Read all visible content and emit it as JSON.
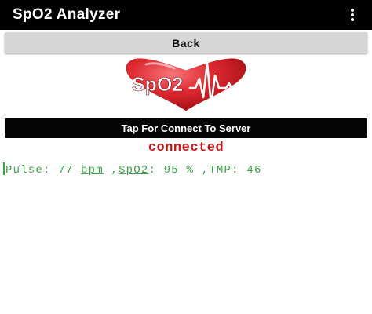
{
  "app_bar": {
    "title": "SpO2 Analyzer",
    "menu_icon": "overflow-menu-icon"
  },
  "back_button": {
    "label": "Back"
  },
  "logo": {
    "text": "SpO2",
    "icon": "heart-pulse-logo"
  },
  "connect_button": {
    "label": "Tap For Connect To Server"
  },
  "status": {
    "text": "connected"
  },
  "readings": {
    "pulse_label": "Pulse:",
    "pulse_value": "77",
    "pulse_unit": "bpm",
    "sep1": ",",
    "spo2_label": "SpO2",
    "spo2_colon": ":",
    "spo2_value": "95",
    "spo2_unit": "%",
    "sep2": ",",
    "tmp_label": "TMP:",
    "tmp_value": "46"
  },
  "colors": {
    "app_bar": "#000000",
    "back_button": "#d6d6d6",
    "connect_button": "#050505",
    "status_text": "#c41a1a",
    "readings_text": "#3aa546",
    "heart": "#d8232a"
  }
}
